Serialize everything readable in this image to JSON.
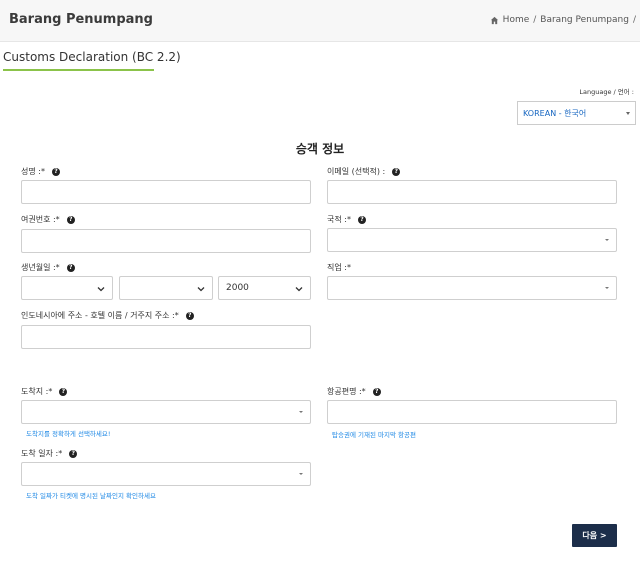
{
  "header": {
    "app_title": "Barang Penumpang",
    "breadcrumb": {
      "home": "Home",
      "current": "Barang Penumpang",
      "trailing_sep": "/"
    }
  },
  "tab": {
    "title": "Customs Declaration (BC 2.2)",
    "accent_color": "#8bc34a"
  },
  "language": {
    "label": "Language / 언어 :",
    "selected": "KOREAN - 한국어"
  },
  "section_title": "승객 정보",
  "fields": {
    "name": {
      "label": "성명 :*"
    },
    "email": {
      "label": "이메일 (선택적) :"
    },
    "passport": {
      "label": "여권번호 :*"
    },
    "nationality": {
      "label": "국적 :*"
    },
    "birthdate": {
      "label": "생년월일 :*",
      "year_selected": "2000"
    },
    "occupation": {
      "label": "직업 :*"
    },
    "address": {
      "label": "인도네시아에 주소 - 호텔 이름 / 거주지 주소 :*"
    },
    "arrival_place": {
      "label": "도착지 :*",
      "hint": "도착지를 정확하게 선택하세요!"
    },
    "flight_number": {
      "label": "항공편명 :*",
      "hint": "탑승권에 기재된 마지막 항공편"
    },
    "arrival_date": {
      "label": "도착 일자 :*",
      "hint": "도착 일짜가 티켓에 명시된 날짜인지 확인하세요"
    }
  },
  "help_glyph": "?",
  "next_button": {
    "label": "다음 >"
  },
  "colors": {
    "button_bg": "#1c2e4a",
    "hint": "#1e88e5",
    "lang_text": "#1565c0"
  }
}
